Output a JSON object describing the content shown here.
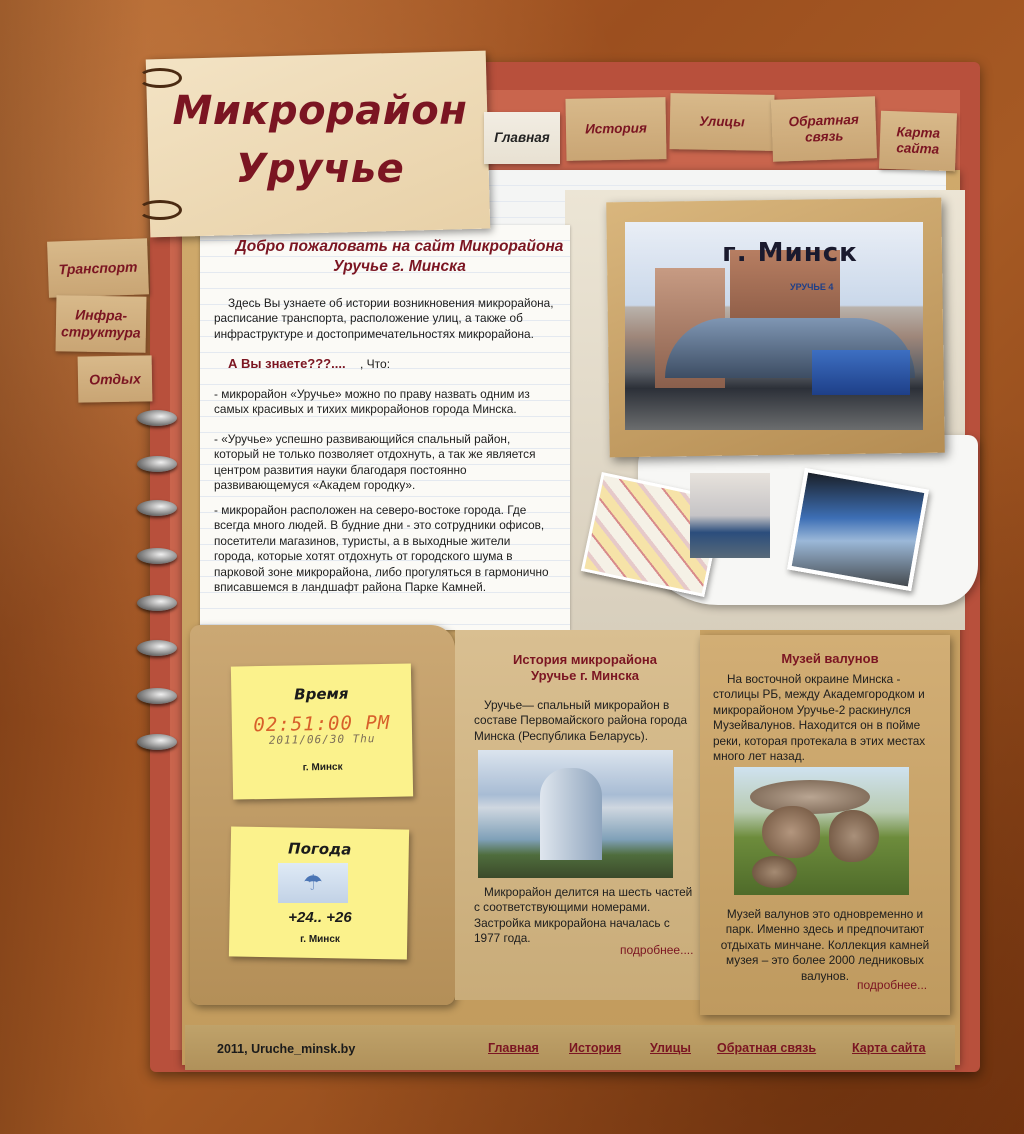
{
  "site": {
    "title_line1": "Микрорайон",
    "title_line2": "Уручье"
  },
  "nav": {
    "items": [
      {
        "label": "Главная"
      },
      {
        "label": "История"
      },
      {
        "label": "Улицы"
      },
      {
        "label": "Обратная связь"
      },
      {
        "label": "Карта сайта"
      }
    ]
  },
  "sidebar": {
    "items": [
      {
        "label": "Транспорт"
      },
      {
        "label": "Инфра-структура"
      },
      {
        "label": "Отдых"
      }
    ]
  },
  "welcome": {
    "title": "Добро пожаловать на сайт Микрорайона Уручье г. Минска",
    "intro": "Здесь Вы узнаете об истории возникновения микрорайона, расписание транспорта, расположение улиц, а также об инфраструктуре и достопримечательностях микрорайона.",
    "know_title": "А Вы знаете???....",
    "know_suffix": ", Что:",
    "facts": [
      "- микрорайон «Уручье» можно по праву назвать одним из самых красивых и тихих микрорайонов города Минска.",
      "- «Уручье» успешно развивающийся спальный район, который не только позволяет отдохнуть, а так же является центром развития науки благодаря постоянно развивающемуся «Академ городку».",
      "- микрорайон расположен на северо-востоке города. Где всегда много людей. В будние дни - это сотрудники офисов, посетители магазинов, туристы, а в выходные жители города, которые хотят отдохнуть от городского шума в  парковой зоне микрорайона, либо прогуляться в гармонично вписавшемся в ландшафт района Парке Камней."
    ]
  },
  "photo": {
    "city_label": "г. Минск",
    "sign_text": "УРУЧЬЕ 4"
  },
  "clock": {
    "title": "Время",
    "time": "02:51:00 PM",
    "date": "2011/06/30 Thu",
    "city": "г. Минск"
  },
  "weather": {
    "title": "Погода",
    "icon": "cloud-rain-icon",
    "temp": "+24.. +26",
    "city": "г. Минск"
  },
  "history": {
    "title": "История микрорайона Уручье г. Минска",
    "text1": "Уручье— спальный микрорайон в составе Первомайского района города Минска (Республика Беларусь).",
    "text2": "Микрорайон делится на шесть частей с соответствующими номерами. Застройка микрорайона началась с 1977 года.",
    "more": "подробнее...."
  },
  "museum": {
    "title": "Музей валунов",
    "text1": "На восточной окраине Минска - столицы РБ, между Академгородком и микрорайоном Уручье-2 раскинулся Музейвалунов. Находится он в пойме реки, которая протекала в этих местах много лет назад.",
    "text2": "Музей валунов это одновременно и парк. Именно здесь и предпочитают отдыхать минчане. Коллекция камней музея – это более 2000 ледниковых валунов.",
    "more": "подробнее..."
  },
  "footer": {
    "copyright": "2011, Uruche_minsk.by",
    "links": [
      {
        "label": "Главная"
      },
      {
        "label": "История"
      },
      {
        "label": "Улицы"
      },
      {
        "label": "Обратная связь"
      },
      {
        "label": "Карта сайта"
      }
    ]
  },
  "colors": {
    "accent": "#7b1522",
    "sticky": "#fbf28c",
    "clock": "#d75f2a"
  }
}
